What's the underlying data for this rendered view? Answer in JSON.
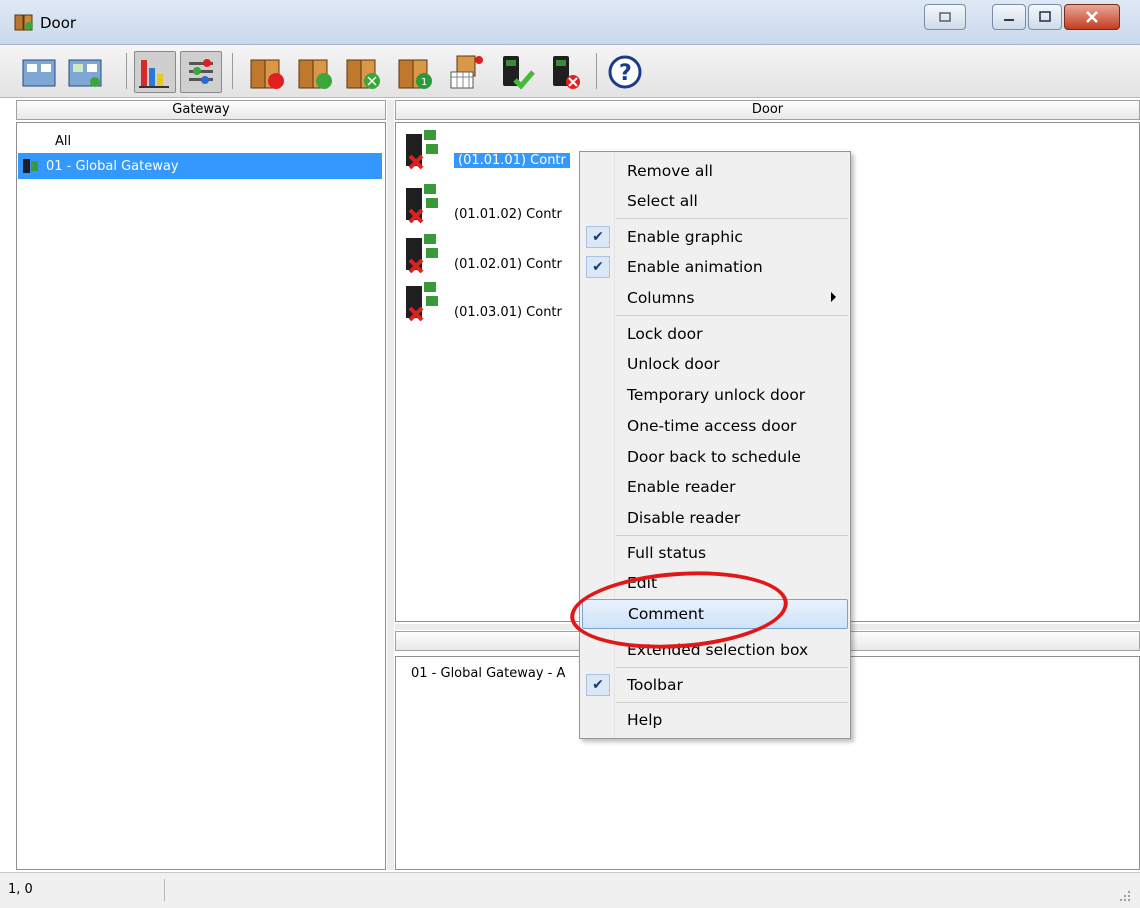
{
  "window": {
    "title": "Door",
    "controls": [
      "minimize-icon",
      "maximize-icon",
      "close-icon"
    ]
  },
  "toolbar": {
    "buttons": [
      "gateway-icon",
      "gateway-status-icon",
      "bar-chart-icon",
      "signal-icon",
      "door-lock-icon",
      "door-unlock-icon",
      "door-temp-unlock-icon",
      "door-one-time-icon",
      "schedule-icon",
      "reader-enable-icon",
      "reader-disable-icon",
      "help-icon"
    ]
  },
  "gateway_pane": {
    "header": "Gateway",
    "all_label": "All",
    "items": [
      "01 - Global Gateway"
    ]
  },
  "door_pane": {
    "header": "Door",
    "items": [
      "(01.01.01) Contr",
      "(01.01.02) Contr",
      "(01.02.01) Contr",
      "(01.03.01) Contr"
    ]
  },
  "lower_pane": {
    "row": "01 - Global Gateway - A"
  },
  "status_bar": {
    "position": "1, 0"
  },
  "context_menu": {
    "items": [
      {
        "label": "Remove all",
        "checked": false
      },
      {
        "label": "Select all",
        "checked": false
      },
      {
        "label": "Enable graphic",
        "checked": true
      },
      {
        "label": "Enable animation",
        "checked": true
      },
      {
        "label": "Columns",
        "checked": false,
        "submenu": true
      },
      {
        "label": "Lock door",
        "checked": false
      },
      {
        "label": "Unlock door",
        "checked": false
      },
      {
        "label": "Temporary unlock door",
        "checked": false
      },
      {
        "label": "One-time access door",
        "checked": false
      },
      {
        "label": "Door back to schedule",
        "checked": false
      },
      {
        "label": "Enable reader",
        "checked": false
      },
      {
        "label": "Disable reader",
        "checked": false
      },
      {
        "label": "Full status",
        "checked": false
      },
      {
        "label": "Edit",
        "checked": false
      },
      {
        "label": "Comment",
        "checked": false,
        "highlighted": true
      },
      {
        "label": "Extended selection box",
        "checked": false
      },
      {
        "label": "Toolbar",
        "checked": true
      },
      {
        "label": "Help",
        "checked": false
      }
    ],
    "check_glyph": "✔"
  }
}
